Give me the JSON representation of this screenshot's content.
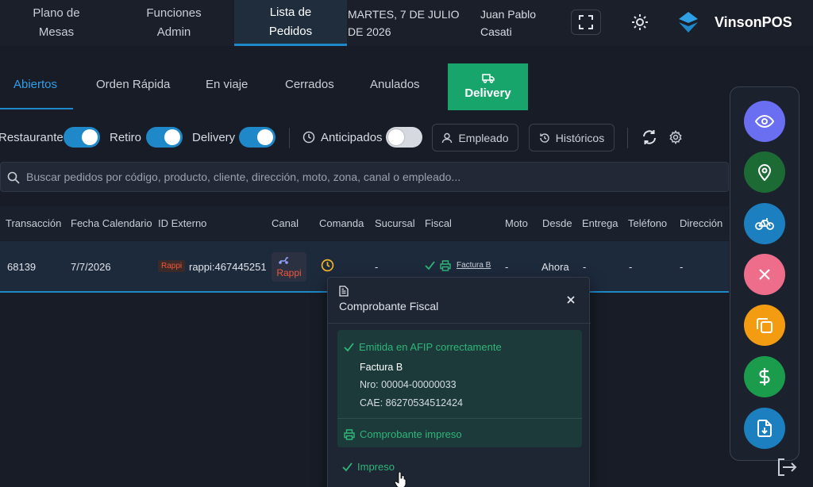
{
  "topbar": {
    "nav": [
      {
        "label": "Plano de\nMesas"
      },
      {
        "label": "Funciones\nAdmin"
      },
      {
        "label": "Lista de\nPedidos"
      }
    ],
    "date": "MARTES, 7 DE JULIO DE 2026",
    "user": "Juan Pablo Casati",
    "brand": "VinsonPOS"
  },
  "tabs": {
    "items": [
      {
        "label": "Abiertos"
      },
      {
        "label": "Orden Rápida"
      },
      {
        "label": "En viaje"
      },
      {
        "label": "Cerrados"
      },
      {
        "label": "Anulados"
      },
      {
        "label": "Delivery"
      }
    ]
  },
  "filters": {
    "restaurante": "Restaurante",
    "retiro": "Retiro",
    "delivery": "Delivery",
    "anticipados": "Anticipados",
    "empleado": "Empleado",
    "historicos": "Históricos"
  },
  "search": {
    "placeholder": "Buscar pedidos por código, producto, cliente, dirección, moto, zona, canal o empleado..."
  },
  "table": {
    "headers": [
      "Transacción",
      "Fecha Calendario",
      "ID Externo",
      "Canal",
      "Comanda",
      "Sucursal",
      "Fiscal",
      "Moto",
      "Desde",
      "Entrega",
      "Teléfono",
      "Dirección"
    ],
    "row": {
      "transaccion": "68139",
      "fecha": "7/7/2026",
      "badge": "Rappi",
      "id_externo": "rappi:467445251",
      "canal": "Rappi",
      "sucursal": "-",
      "fiscal": "Factura B",
      "moto": "-",
      "desde": "Ahora",
      "entrega": "-",
      "telefono": "-",
      "direccion": "-"
    }
  },
  "popover": {
    "title": "Comprobante Fiscal",
    "status": "Emitida en AFIP correctamente",
    "tipo": "Factura B",
    "nro": "Nro: 00004-00000033",
    "cae": "CAE: 86270534512424",
    "printed_status": "Comprobante impreso",
    "impreso": "Impreso"
  },
  "colors": {
    "accent": "#1e88c9",
    "success": "#18a56c",
    "rappi": "#f0563c"
  }
}
